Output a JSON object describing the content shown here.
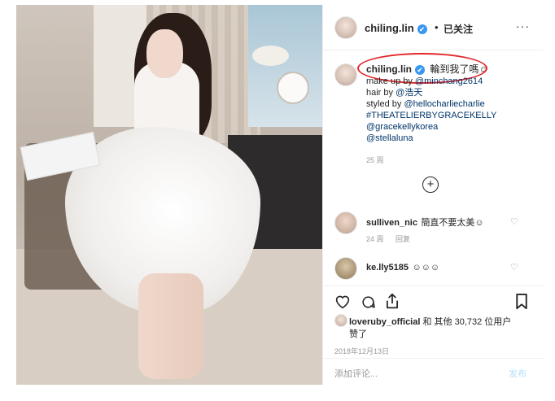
{
  "header": {
    "username": "chiling.lin",
    "verified_mark": "✔",
    "separator": "•",
    "follow_label": "已关注",
    "more_label": "···"
  },
  "caption": {
    "username": "chiling.lin",
    "text": "輪到我了嗎☺",
    "lines": [
      {
        "prefix": "make up by ",
        "link": "@minchang2614"
      },
      {
        "prefix": "hair by ",
        "link": "@浩天"
      },
      {
        "prefix": "styled by ",
        "link": "@hellocharliecharlie"
      },
      {
        "prefix": "",
        "link": "#THEATELIERBYGRACEKELLY"
      },
      {
        "prefix": "",
        "link": "@gracekellykorea"
      },
      {
        "prefix": "",
        "link": "@stellaluna"
      }
    ],
    "time": "25 周"
  },
  "load_more_label": "+",
  "comments": [
    {
      "username": "sulliven_nic",
      "text": "簡直不要太美☺",
      "time": "24 周",
      "reply_label": "回复"
    },
    {
      "username": "ke.lly5185",
      "text": "☺☺☺"
    }
  ],
  "likes": {
    "liker": "loveruby_official",
    "text_a": " 和 其他 30,732 位用户",
    "text_b": "赞了"
  },
  "date": "2018年12月13日",
  "comment_input": {
    "placeholder": "添加评论...",
    "post_label": "发布"
  },
  "icons": {
    "heart": "heart-icon",
    "comment": "comment-icon",
    "share": "share-icon",
    "save": "bookmark-icon"
  },
  "colors": {
    "link": "#003569",
    "verified": "#3897f0",
    "annotation": "#e3262b"
  }
}
